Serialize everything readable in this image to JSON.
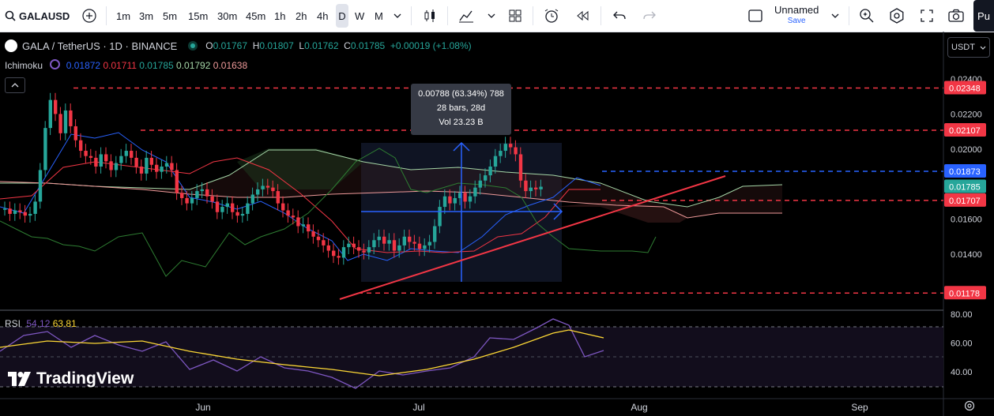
{
  "toolbar": {
    "symbol": "GALAUSD",
    "timeframes": [
      "1m",
      "3m",
      "5m",
      "15m",
      "30m",
      "45m",
      "1h",
      "2h",
      "4h",
      "D",
      "W",
      "M"
    ],
    "active_timeframe": "D",
    "layout_name": "Unnamed",
    "layout_status": "Save",
    "publish_label": "Pu"
  },
  "legend": {
    "title": "GALA / TetherUS · 1D · BINANCE",
    "o_label": "O",
    "o": "0.01767",
    "h_label": "H",
    "h": "0.01807",
    "l_label": "L",
    "l": "0.01762",
    "c_label": "C",
    "c": "0.01785",
    "change": "+0.00019 (+1.08%)"
  },
  "ichimoku": {
    "name": "Ichimoku",
    "v1": "0.01872",
    "v2": "0.01711",
    "v3": "0.01785",
    "v4": "0.01792",
    "v5": "0.01638"
  },
  "rsi": {
    "name": "RSI",
    "v1": "54.12",
    "v2": "63.81"
  },
  "currency": "USDT",
  "measure": {
    "line1": "0.00788 (63.34%) 788",
    "line2": "28 bars, 28d",
    "line3": "Vol 23.23 B"
  },
  "price_axis": {
    "ticks": [
      "0.02400",
      "0.02200",
      "0.02000",
      "0.01600",
      "0.01400"
    ],
    "tags": [
      {
        "value": "0.02348",
        "color": "#f23645"
      },
      {
        "value": "0.02107",
        "color": "#f23645"
      },
      {
        "value": "0.01873",
        "color": "#2962ff"
      },
      {
        "value": "0.01785",
        "color": "#26a69a"
      },
      {
        "value": "0.01707",
        "color": "#f23645"
      },
      {
        "value": "0.01178",
        "color": "#f23645"
      }
    ]
  },
  "rsi_axis": {
    "ticks": [
      "80.00",
      "60.00",
      "40.00"
    ]
  },
  "time_axis": {
    "labels": [
      "Jun",
      "Jul",
      "Aug",
      "Sep"
    ]
  },
  "branding": "TradingView",
  "colors": {
    "up": "#26a69a",
    "down": "#f23645",
    "blue": "#2962ff",
    "rsi": "#7e57c2",
    "rsi_ma": "#fdd835"
  }
}
